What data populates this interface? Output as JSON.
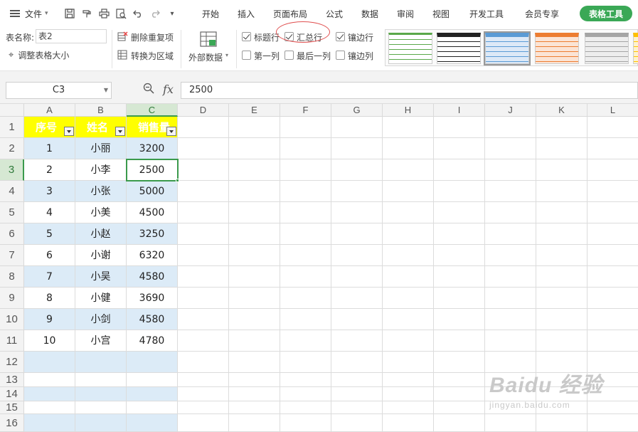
{
  "menu": {
    "file_label": "文件",
    "tabs": [
      "开始",
      "插入",
      "页面布局",
      "公式",
      "数据",
      "审阅",
      "视图",
      "开发工具",
      "会员专享"
    ],
    "active_tab": "表格工具"
  },
  "ribbon": {
    "table_name_label": "表名称:",
    "table_name_value": "表2",
    "resize_table": "调整表格大小",
    "remove_duplicates": "删除重复项",
    "convert_to_range": "转换为区域",
    "external_data": "外部数据",
    "checkboxes": [
      {
        "label": "标题行",
        "checked": true
      },
      {
        "label": "汇总行",
        "checked": true
      },
      {
        "label": "镶边行",
        "checked": true
      },
      {
        "label": "第一列",
        "checked": false
      },
      {
        "label": "最后一列",
        "checked": false
      },
      {
        "label": "镶边列",
        "checked": false
      }
    ],
    "style_gallery": [
      {
        "name": "green-style",
        "color": "#5aa84a"
      },
      {
        "name": "black-style",
        "color": "#222222"
      },
      {
        "name": "blue-style",
        "color": "#5b9bd5"
      },
      {
        "name": "orange-style",
        "color": "#ed7d31"
      },
      {
        "name": "gray-style",
        "color": "#a5a5a5"
      },
      {
        "name": "yellow-style",
        "color": "#ffc000"
      }
    ]
  },
  "formula_bar": {
    "cell_ref": "C3",
    "fx": "fx",
    "value": "2500"
  },
  "sheet": {
    "columns": [
      "A",
      "B",
      "C",
      "D",
      "E",
      "F",
      "G",
      "H",
      "I",
      "J",
      "K",
      "L"
    ],
    "rows": [
      "1",
      "2",
      "3",
      "4",
      "5",
      "6",
      "7",
      "8",
      "9",
      "10",
      "11",
      "12",
      "13",
      "14",
      "15",
      "16"
    ],
    "header": [
      "序号",
      "姓名",
      "销售量"
    ],
    "data": [
      [
        "1",
        "小丽",
        "3200"
      ],
      [
        "2",
        "小李",
        "2500"
      ],
      [
        "3",
        "小张",
        "5000"
      ],
      [
        "4",
        "小美",
        "4500"
      ],
      [
        "5",
        "小赵",
        "3250"
      ],
      [
        "6",
        "小谢",
        "6320"
      ],
      [
        "7",
        "小吴",
        "4580"
      ],
      [
        "8",
        "小健",
        "3690"
      ],
      [
        "9",
        "小剑",
        "4580"
      ],
      [
        "10",
        "小宫",
        "4780"
      ]
    ],
    "header_fill": "#ffff00",
    "band_fill": "#dcebf7",
    "selection_color": "#3b9a4c"
  },
  "watermark": {
    "brand": "Baidu 经验",
    "url": "jingyan.baidu.com"
  }
}
